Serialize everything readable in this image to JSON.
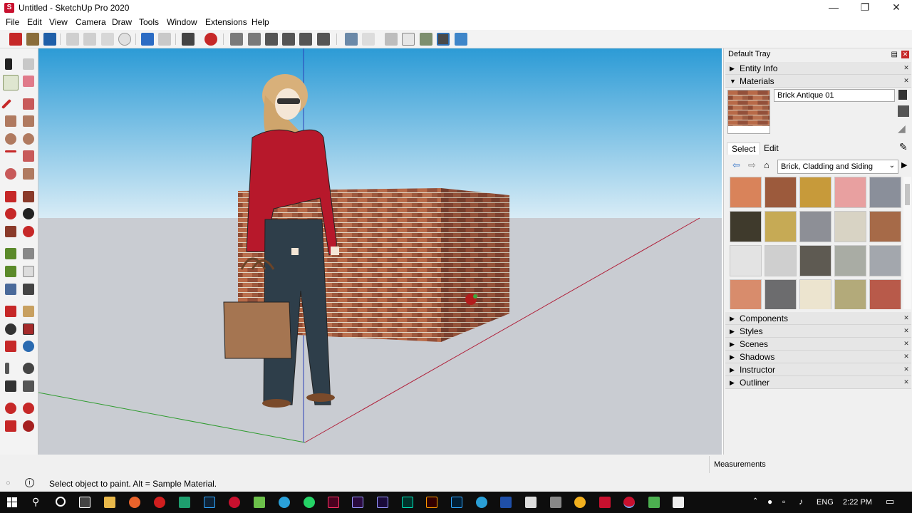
{
  "window": {
    "title": "Untitled - SketchUp Pro 2020",
    "minimize_icon": "minimize-icon",
    "maximize_icon": "restore-icon",
    "close_icon": "close-icon"
  },
  "menu": {
    "items": [
      "File",
      "Edit",
      "View",
      "Camera",
      "Draw",
      "Tools",
      "Window",
      "Extensions",
      "Help"
    ]
  },
  "tray": {
    "title": "Default Tray",
    "panels": {
      "entity_info": "Entity Info",
      "materials": "Materials",
      "components": "Components",
      "styles": "Styles",
      "scenes": "Scenes",
      "shadows": "Shadows",
      "instructor": "Instructor",
      "outliner": "Outliner"
    },
    "material_name": "Brick Antique 01",
    "tabs": {
      "select": "Select",
      "edit": "Edit"
    },
    "collection": "Brick, Cladding and Siding",
    "swatch_colors": [
      "#d9835a",
      "#9c5a3c",
      "#c79a3a",
      "#e8a0a0",
      "#8a8f9a",
      "#3f3a2c",
      "#c6aa55",
      "#8d8f96",
      "#d8d3c4",
      "#a66a48",
      "#e3e3e3",
      "#cfcfcf",
      "#5e5a52",
      "#a9aca4",
      "#a3a7ad",
      "#d88c6c",
      "#6c6c6e",
      "#ece4cf",
      "#b3aa7a",
      "#b85a4a"
    ]
  },
  "status": {
    "message": "Select object to paint. Alt = Sample Material.",
    "measurements_label": "Measurements"
  },
  "taskbar": {
    "lang": "ENG",
    "time": "2:22 PM"
  },
  "colors": {
    "sky_top": "#2c9bd6",
    "sky_bottom": "#d8ecf6",
    "ground": "#c9ccd2",
    "brick": "#9a4e36",
    "shirt": "#b7182b",
    "jeans": "#2e3e4a",
    "bag": "#a57551"
  }
}
